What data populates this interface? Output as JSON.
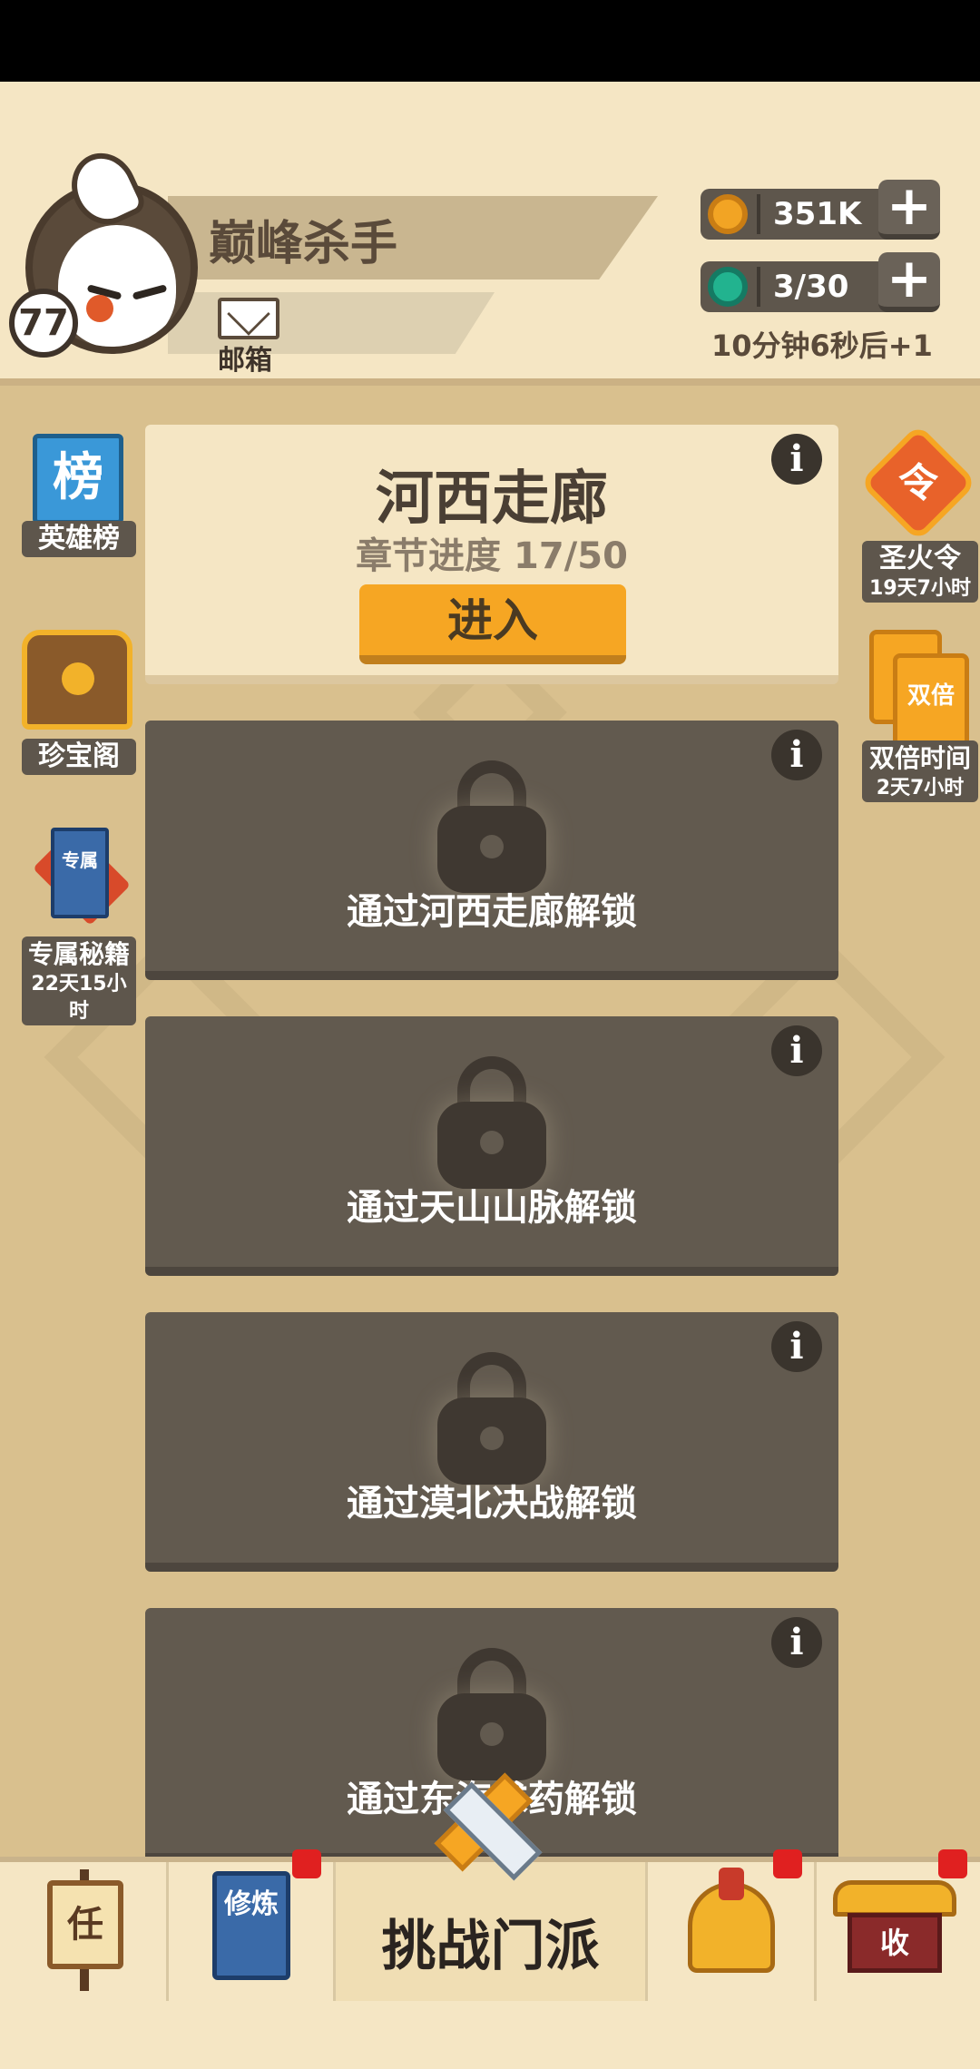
{
  "player": {
    "name": "巅峰杀手",
    "level": "77",
    "mail_label": "邮箱"
  },
  "resources": {
    "coins": "351K",
    "energy": "3/30",
    "regen_text": "10分钟6秒后+1",
    "plus": "+"
  },
  "left_side": {
    "ranking": {
      "icon_text": "榜",
      "label": "英雄榜"
    },
    "treasure": {
      "label": "珍宝阁"
    },
    "secret_book": {
      "icon_text": "专属",
      "label": "专属秘籍",
      "timer": "22天15小时"
    }
  },
  "right_side": {
    "holy_fire": {
      "icon_text": "令",
      "label": "圣火令",
      "timer": "19天7小时"
    },
    "double_time": {
      "icon_text": "双倍",
      "label": "双倍时间",
      "timer": "2天7小时"
    }
  },
  "chapters": {
    "active": {
      "title": "河西走廊",
      "progress": "章节进度 17/50",
      "enter_label": "进入"
    },
    "locked": [
      {
        "text": "通过河西走廊解锁"
      },
      {
        "text": "通过天山山脉解锁"
      },
      {
        "text": "通过漠北决战解锁"
      },
      {
        "text": "通过东海求药解锁"
      }
    ],
    "info": "i"
  },
  "bottom_nav": {
    "tasks_icon_text": "任",
    "cultivate_icon_text": "修炼",
    "challenge_label": "挑战门派",
    "collect_icon_text": "收"
  },
  "colors": {
    "accent_orange": "#f6a623",
    "locked_card": "#625a4f",
    "header_bg": "#f5e6c4",
    "main_bg": "#d9c08e",
    "notify_red": "#e02020"
  }
}
